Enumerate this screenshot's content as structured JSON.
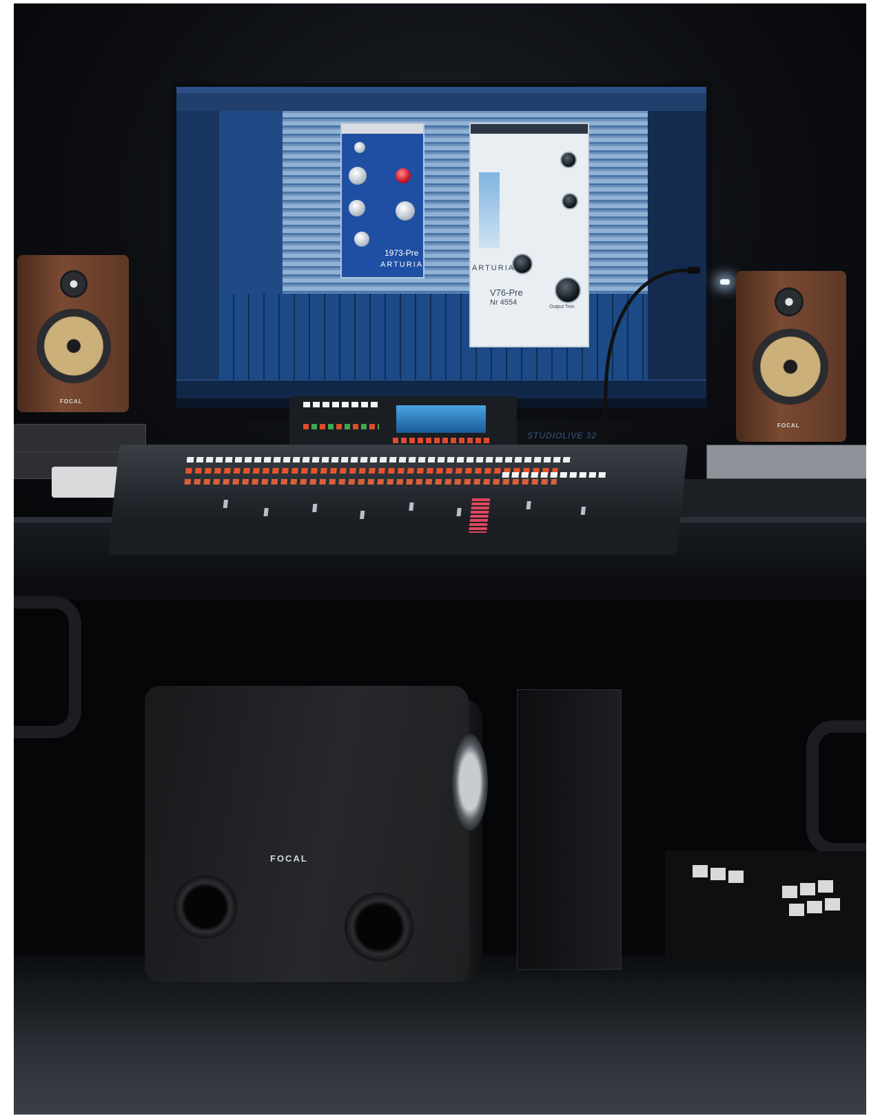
{
  "plugins": {
    "left": {
      "name": "1973-Pre",
      "brand": "ARTURIA"
    },
    "right": {
      "name": "V76-Pre",
      "serial": "Nr 4554",
      "brand": "ARTURIA",
      "knob_label_1": "Output Trim"
    }
  },
  "console": {
    "label": "STUDIOLIVE 32"
  },
  "speakers": {
    "left_brand": "FOCAL",
    "right_brand": "FOCAL"
  },
  "subwoofer": {
    "brand": "FOCAL"
  },
  "colors": {
    "screen_blue": "#1c3f74",
    "plugin_blue": "#1f4fa2",
    "speaker_wood": "#7a4a32"
  }
}
